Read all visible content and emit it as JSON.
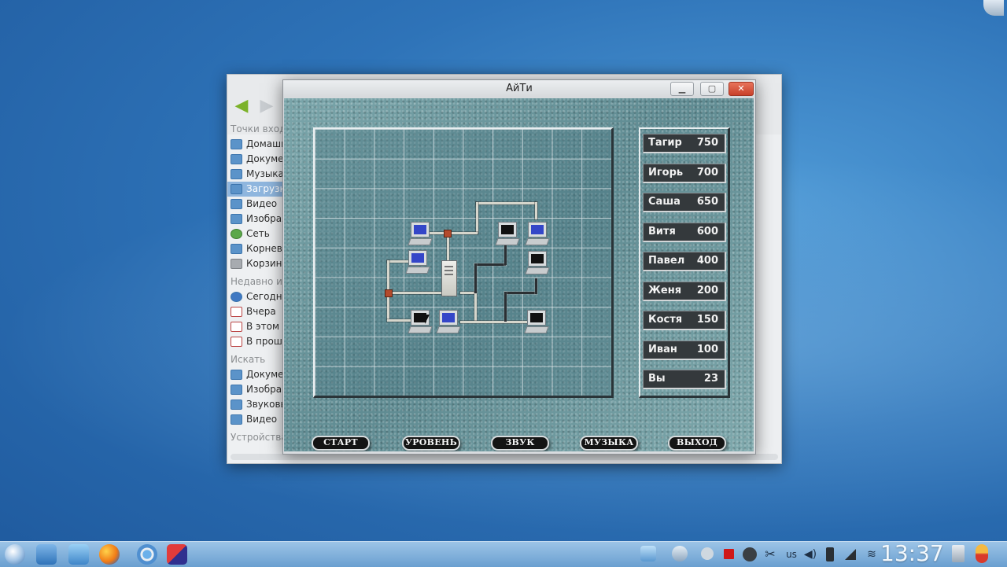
{
  "desktop": {
    "file_manager": {
      "sections": [
        {
          "title": "Точки вход",
          "items": [
            {
              "label": "Домашн",
              "icon": "folder-icon",
              "selected": false
            },
            {
              "label": "Докумен",
              "icon": "folder-icon",
              "selected": false
            },
            {
              "label": "Музыка",
              "icon": "folder-icon",
              "selected": false
            },
            {
              "label": "Загрузк",
              "icon": "folder-icon",
              "selected": true
            },
            {
              "label": "Видео",
              "icon": "folder-icon",
              "selected": false
            },
            {
              "label": "Изображ",
              "icon": "folder-icon",
              "selected": false
            },
            {
              "label": "Сеть",
              "icon": "network-icon",
              "selected": false
            },
            {
              "label": "Корнева",
              "icon": "folder-icon",
              "selected": false
            },
            {
              "label": "Корзина",
              "icon": "trash-icon",
              "selected": false
            }
          ]
        },
        {
          "title": "Недавно исп",
          "items": [
            {
              "label": "Сегодня",
              "icon": "recent-icon",
              "selected": false
            },
            {
              "label": "Вчера",
              "icon": "calendar-icon",
              "selected": false
            },
            {
              "label": "В этом м",
              "icon": "calendar-icon",
              "selected": false
            },
            {
              "label": "В прошл",
              "icon": "calendar-icon",
              "selected": false
            }
          ]
        },
        {
          "title": "Искать",
          "items": [
            {
              "label": "Докумен",
              "icon": "folder-icon",
              "selected": false
            },
            {
              "label": "Изображ",
              "icon": "folder-icon",
              "selected": false
            },
            {
              "label": "Звуковы",
              "icon": "folder-icon",
              "selected": false
            },
            {
              "label": "Видео",
              "icon": "folder-icon",
              "selected": false
            }
          ]
        },
        {
          "title": "Устройства",
          "items": []
        }
      ]
    },
    "game_window": {
      "title": "АйТи",
      "controls": {
        "minimize": "▁",
        "maximize": "▢",
        "close": "✕"
      },
      "scores": [
        {
          "name": "Тагир",
          "score": "750"
        },
        {
          "name": "Игорь",
          "score": "700"
        },
        {
          "name": "Саша",
          "score": "650"
        },
        {
          "name": "Витя",
          "score": "600"
        },
        {
          "name": "Павел",
          "score": "400"
        },
        {
          "name": "Женя",
          "score": "200"
        },
        {
          "name": "Костя",
          "score": "150"
        },
        {
          "name": "Иван",
          "score": "100"
        },
        {
          "name": "Вы",
          "score": "23"
        }
      ],
      "buttons": {
        "start": "СТАРТ",
        "level": "УРОВЕНЬ",
        "sound": "ЗВУК",
        "music": "МУЗЫКА",
        "exit": "ВЫХОД"
      }
    },
    "taskbar": {
      "keyboard_layout": "us",
      "clock": "13:37",
      "colors": {
        "accent": "#6a9fd0",
        "score_bg": "#34393c"
      }
    }
  }
}
